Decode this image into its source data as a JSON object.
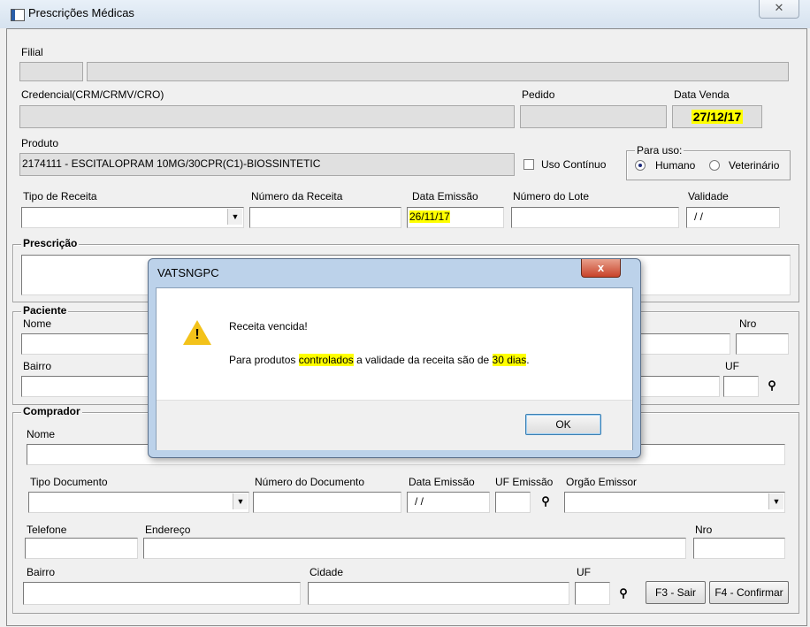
{
  "window": {
    "title": "Prescrições Médicas",
    "close_glyph": "✕"
  },
  "header": {
    "filial_label": "Filial",
    "credencial_label": "Credencial(CRM/CRMV/CRO)",
    "pedido_label": "Pedido",
    "data_venda_label": "Data Venda",
    "data_venda_value": "27/12/17",
    "produto_label": "Produto",
    "produto_value": "2174111 - ESCITALOPRAM 10MG/30CPR(C1)-BIOSSINTETIC",
    "uso_continuo_label": "Uso Contínuo",
    "para_uso_label": "Para uso:",
    "humano_label": "Humano",
    "veterinario_label": "Veterinário",
    "tipo_receita_label": "Tipo de Receita",
    "numero_receita_label": "Número da Receita",
    "data_emissao_label": "Data Emissão",
    "data_emissao_value": "26/11/17",
    "numero_lote_label": "Número do Lote",
    "validade_label": "Validade",
    "validade_value": "/ /"
  },
  "prescricao": {
    "legend": "Prescrição"
  },
  "paciente": {
    "legend": "Paciente",
    "nome_label": "Nome",
    "nro_label": "Nro",
    "bairro_label": "Bairro",
    "uf_label": "UF"
  },
  "comprador": {
    "legend": "Comprador",
    "nome_label": "Nome",
    "tipo_documento_label": "Tipo Documento",
    "numero_documento_label": "Número do Documento",
    "data_emissao_label": "Data Emissão",
    "data_emissao_value": "/ /",
    "uf_emissao_label": "UF Emissão",
    "orgao_emissor_label": "Orgão Emissor",
    "telefone_label": "Telefone",
    "endereco_label": "Endereço",
    "nro_label": "Nro",
    "bairro_label": "Bairro",
    "cidade_label": "Cidade",
    "uf_label": "UF"
  },
  "buttons": {
    "sair": "F3 - Sair",
    "confirmar": "F4 - Confirmar"
  },
  "dialog": {
    "title": "VATSNGPC",
    "close_glyph": "x",
    "line1": "Receita vencida!",
    "line2_a": "Para produtos ",
    "line2_b": "controlados",
    "line2_c": " a validade da receita são de ",
    "line2_d": "30 dias",
    "line2_e": ".",
    "ok_label": "OK"
  },
  "icons": {
    "binoculars": "binoculars-icon",
    "warning": "warning-icon",
    "dropdown": "chevron-down-icon"
  },
  "colors": {
    "highlight": "#ffff00",
    "window_bg": "#f0f0f0"
  }
}
